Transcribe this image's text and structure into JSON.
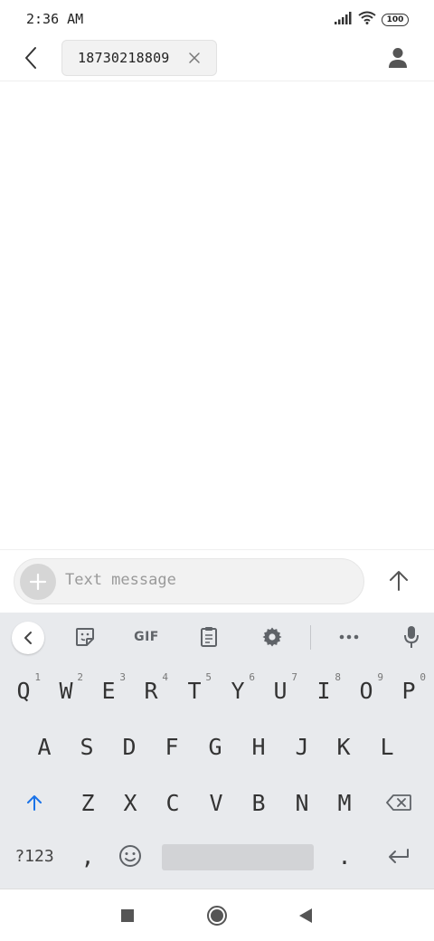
{
  "status_bar": {
    "time": "2:36 AM",
    "battery": "100",
    "icons": [
      "signal-icon",
      "wifi-icon",
      "battery-icon"
    ]
  },
  "header": {
    "back_icon": "back-arrow-icon",
    "recipient": "18730218809",
    "remove_icon": "close-icon",
    "contact_icon": "person-icon"
  },
  "compose": {
    "attach_icon": "plus-icon",
    "placeholder": "Text message",
    "value": "",
    "send_icon": "send-arrow-icon"
  },
  "keyboard": {
    "toolbar": {
      "collapse_icon": "chevron-left-icon",
      "sticker_icon": "sticker-icon",
      "gif_label": "GIF",
      "clipboard_icon": "clipboard-icon",
      "settings_icon": "gear-icon",
      "more_icon": "more-dots-icon",
      "mic_icon": "microphone-icon"
    },
    "row1": [
      {
        "label": "Q",
        "hint": "1"
      },
      {
        "label": "W",
        "hint": "2"
      },
      {
        "label": "E",
        "hint": "3"
      },
      {
        "label": "R",
        "hint": "4"
      },
      {
        "label": "T",
        "hint": "5"
      },
      {
        "label": "Y",
        "hint": "6"
      },
      {
        "label": "U",
        "hint": "7"
      },
      {
        "label": "I",
        "hint": "8"
      },
      {
        "label": "O",
        "hint": "9"
      },
      {
        "label": "P",
        "hint": "0"
      }
    ],
    "row2": [
      "A",
      "S",
      "D",
      "F",
      "G",
      "H",
      "J",
      "K",
      "L"
    ],
    "row3": [
      "Z",
      "X",
      "C",
      "V",
      "B",
      "N",
      "M"
    ],
    "shift_icon": "shift-arrow-icon",
    "backspace_icon": "backspace-icon",
    "symbols_label": "?123",
    "comma_label": ",",
    "emoji_icon": "emoji-icon",
    "period_label": ".",
    "enter_icon": "enter-icon",
    "accent_color": "#1a73e8"
  },
  "nav_bar": {
    "recents_icon": "square-icon",
    "home_icon": "circle-icon",
    "back_icon": "triangle-back-icon"
  }
}
